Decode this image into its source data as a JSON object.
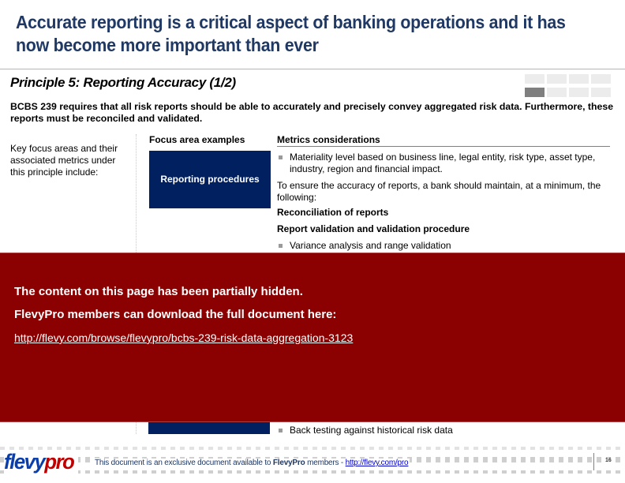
{
  "slide": {
    "title": "Accurate reporting is a critical aspect of banking operations and it has now become more important than ever",
    "section_title": "Principle 5:  Reporting Accuracy (1/2)",
    "nav_grid": {
      "rows": 2,
      "cols": 4,
      "active_index": 4
    },
    "intro": "BCBS 239 requires that all risk reports should be able to accurately and precisely convey aggregated risk data. Furthermore, these reports must be reconciled and validated.",
    "left_note": "Key focus areas and their associated metrics under this principle include:",
    "columns": {
      "focus_header": "Focus area examples",
      "metrics_header": "Metrics considerations"
    },
    "focus_areas": [
      {
        "label": "Reporting procedures"
      }
    ],
    "metrics": {
      "bullet1": "Materiality level based on business line, legal entity, risk type, asset type, industry, region and financial impact.",
      "para1": "To ensure the accuracy of reports, a bank should maintain, at a minimum, the following:",
      "heading1": "Reconciliation of reports",
      "heading2": "Report validation and validation procedure",
      "bullet2": "Variance analysis and range validation",
      "bullet_last": "Back testing against historical risk data"
    }
  },
  "overlay": {
    "line1": "The content on this page has been partially hidden.",
    "line2": "FlevyPro members can download the full document here:",
    "link": "http://flevy.com/browse/flevypro/bcbs-239-risk-data-aggregation-3123",
    "color": "#8b0000"
  },
  "footer": {
    "logo_part1": "flevy",
    "logo_part2": "pro",
    "text_before": "This document is an exclusive document available to ",
    "text_brand": "FlevyPro",
    "text_after": " members - ",
    "link": "http://flevy.com/pro",
    "page_number": "16"
  },
  "colors": {
    "title": "#1f3864",
    "focus_box": "#002060",
    "overlay": "#8b0000"
  }
}
